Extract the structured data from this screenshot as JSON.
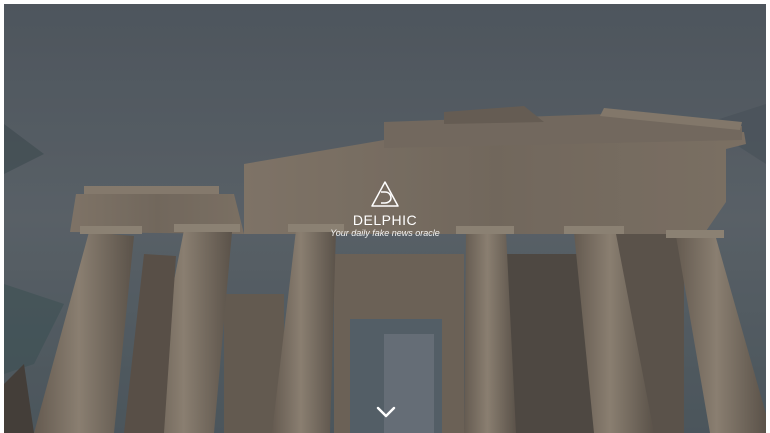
{
  "hero": {
    "background": "photo of ancient Greek temple ruins with doric columns under a cloudy sky",
    "brand": {
      "logo_icon": "delta-triangle-logo-icon",
      "title": "DELPHIC",
      "tagline": "Your daily fake news oracle"
    },
    "scroll_icon": "chevron-down-icon",
    "colors": {
      "text": "#ffffff",
      "sky": "#5b6670",
      "stone": "#9c8c78"
    }
  }
}
